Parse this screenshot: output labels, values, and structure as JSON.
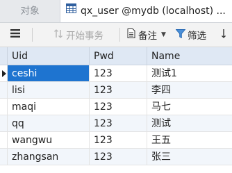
{
  "tabs": {
    "objects_label": "对象",
    "active_label": "qx_user @mydb (localhost) ..."
  },
  "toolbar": {
    "begin_transaction": "开始事务",
    "note": "备注",
    "filter": "筛选",
    "sort": "排"
  },
  "table": {
    "columns": [
      "Uid",
      "Pwd",
      "Name"
    ],
    "rows": [
      {
        "uid": "ceshi",
        "pwd": "123",
        "name": "测试1"
      },
      {
        "uid": "lisi",
        "pwd": "123",
        "name": "李四"
      },
      {
        "uid": "maqi",
        "pwd": "123",
        "name": "马七"
      },
      {
        "uid": "qq",
        "pwd": "123",
        "name": "测试"
      },
      {
        "uid": "wangwu",
        "pwd": "123",
        "name": "王五"
      },
      {
        "uid": "zhangsan",
        "pwd": "123",
        "name": "张三"
      }
    ],
    "selected_row": 0
  },
  "colors": {
    "selection": "#1e74d0",
    "header_bg": "#dfe8f4",
    "alt_row_bg": "#f2f6fb"
  }
}
